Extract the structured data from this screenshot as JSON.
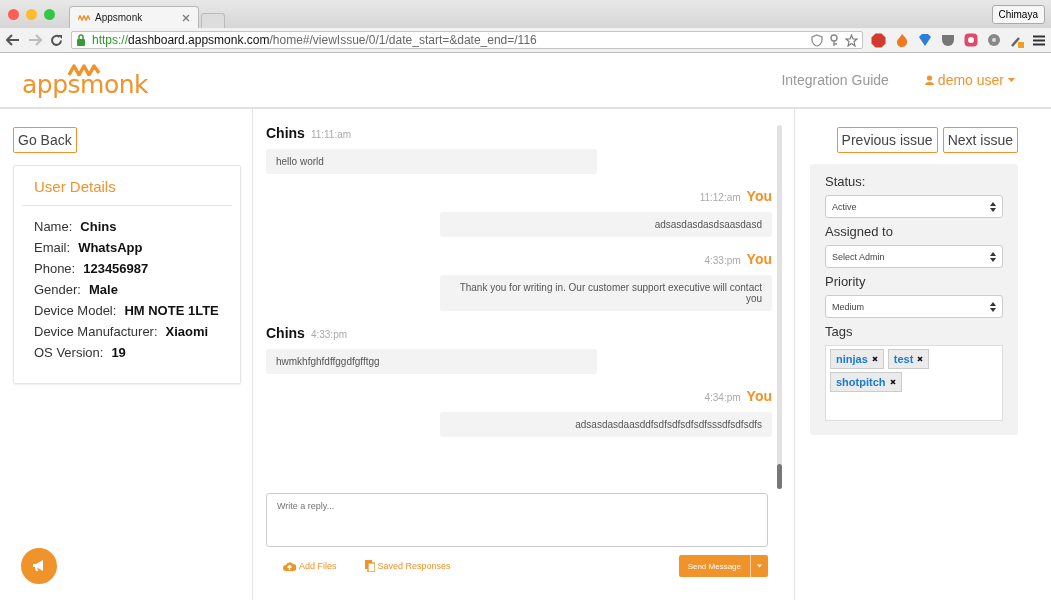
{
  "browser": {
    "tab_title": "Appsmonk",
    "profile": "Chimaya",
    "url": {
      "scheme": "https://",
      "host": "dashboard.appsmonk.com",
      "path": "/home#/viewIssue/0/1/date_start=&date_end=/116"
    }
  },
  "header": {
    "logo": "appsmonk",
    "nav_link": "Integration Guide",
    "user_menu": "demo user"
  },
  "go_back": "Go Back",
  "user_details": {
    "title": "User Details",
    "fields": [
      {
        "label": "Name:",
        "value": "Chins"
      },
      {
        "label": "Email:",
        "value": "WhatsApp"
      },
      {
        "label": "Phone:",
        "value": "123456987"
      },
      {
        "label": "Gender:",
        "value": "Male"
      },
      {
        "label": "Device Model:",
        "value": "HM NOTE 1LTE"
      },
      {
        "label": "Device Manufacturer:",
        "value": "Xiaomi"
      },
      {
        "label": "OS Version:",
        "value": "19"
      }
    ]
  },
  "messages": [
    {
      "kind": "customer",
      "sender": "Chins",
      "time": "11:11:am",
      "text": "hello world"
    },
    {
      "kind": "agent",
      "sender": "You",
      "time": "11:12:am",
      "text": "adsasdasdasdsaasdasd"
    },
    {
      "kind": "agent",
      "sender": "You",
      "time": "4:33:pm",
      "text": "Thank you for writing in. Our customer support executive will contact you"
    },
    {
      "kind": "customer",
      "sender": "Chins",
      "time": "4:33:pm",
      "text": "hwmkhfghfdffggdfgfftgg"
    },
    {
      "kind": "agent",
      "sender": "You",
      "time": "4:34:pm",
      "text": "adsasdasdaasddfsdfsdfsdfsdfsssdfsdfsdfs"
    }
  ],
  "reply": {
    "placeholder": "Write a reply...",
    "add_files": "Add Files",
    "saved_responses": "Saved Responses",
    "send": "Send Message"
  },
  "issue_nav": {
    "previous": "Previous issue",
    "next": "Next issue"
  },
  "issue_form": {
    "selects": [
      {
        "label": "Status:",
        "value": "Active"
      },
      {
        "label": "Assigned to",
        "value": "Select Admin"
      },
      {
        "label": "Priority",
        "value": "Medium"
      }
    ],
    "tags_label": "Tags",
    "tags": [
      "ninjas",
      "test",
      "shotpitch"
    ]
  }
}
